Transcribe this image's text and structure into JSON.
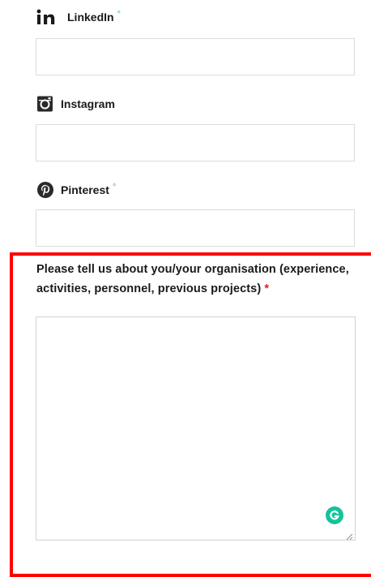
{
  "fields": [
    {
      "label": "LinkedIn",
      "icon": "linkedin-icon",
      "optional_marker": "°",
      "value": ""
    },
    {
      "label": "Instagram",
      "icon": "instagram-icon",
      "optional_marker": "",
      "value": ""
    },
    {
      "label": "Pinterest",
      "icon": "pinterest-icon",
      "optional_marker": "°",
      "value": ""
    }
  ],
  "about": {
    "label": "Please tell us about you/your organisation (experience, activities, personnel, previous projects)",
    "required_marker": "*",
    "value": ""
  },
  "colors": {
    "highlight": "#ff0000",
    "required": "#e02020",
    "optional_dot": "#4fa3d8",
    "grammarly": "#15c39a"
  }
}
